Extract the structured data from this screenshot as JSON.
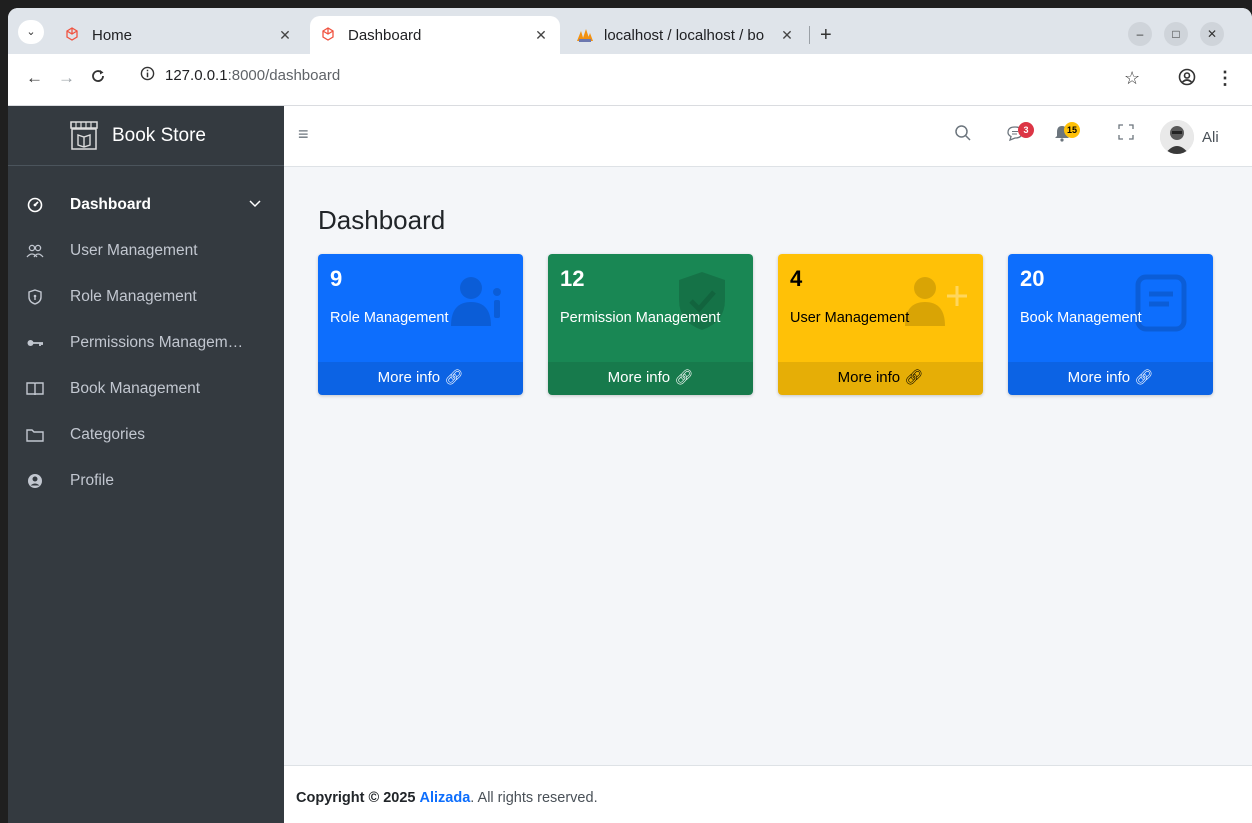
{
  "browser": {
    "tabs": [
      {
        "title": "Home",
        "favicon": "laravel-icon"
      },
      {
        "title": "Dashboard",
        "favicon": "laravel-icon",
        "active": true
      },
      {
        "title": "localhost / localhost / bo",
        "favicon": "phpmyadmin-icon"
      }
    ],
    "url_host": "127.0.0.1",
    "url_path": ":8000/dashboard"
  },
  "sidebar": {
    "brand": "Book Store",
    "items": [
      {
        "label": "Dashboard",
        "icon": "speedometer-icon",
        "active": true
      },
      {
        "label": "User Management",
        "icon": "people-icon"
      },
      {
        "label": "Role Management",
        "icon": "shield-icon"
      },
      {
        "label": "Permissions Managem…",
        "icon": "key-icon"
      },
      {
        "label": "Book Management",
        "icon": "book-icon"
      },
      {
        "label": "Categories",
        "icon": "folder-icon"
      },
      {
        "label": "Profile",
        "icon": "person-circle-icon"
      }
    ]
  },
  "header": {
    "messages_badge": "3",
    "notifications_badge": "15",
    "user_name": "Ali"
  },
  "main": {
    "title": "Dashboard",
    "boxes": [
      {
        "count": "9",
        "label": "Role Management",
        "link": "More info",
        "color": "#0d6efd",
        "footer_color": "#0c63e4",
        "text_color": "#ffffff"
      },
      {
        "count": "12",
        "label": "Permission Management",
        "link": "More info",
        "color": "#198754",
        "footer_color": "#177a4c",
        "text_color": "#ffffff"
      },
      {
        "count": "4",
        "label": "User Management",
        "link": "More info",
        "color": "#ffc107",
        "footer_color": "#e6ae06",
        "text_color": "#000000"
      },
      {
        "count": "20",
        "label": "Book Management",
        "link": "More info",
        "color": "#0d6efd",
        "footer_color": "#0c63e4",
        "text_color": "#ffffff"
      }
    ]
  },
  "footer": {
    "copyright": "Copyright © 2025",
    "author": "Alizada",
    "rights": ". All rights reserved."
  }
}
